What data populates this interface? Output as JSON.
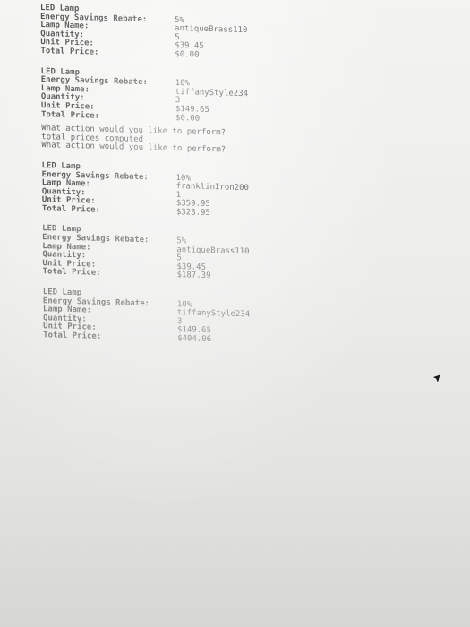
{
  "blocks": [
    {
      "header": "LED Lamp",
      "rows": [
        {
          "label": "Energy Savings Rebate:",
          "value": "5%"
        },
        {
          "label": "Lamp Name:",
          "value": "antiqueBrass110"
        },
        {
          "label": "Quantity:",
          "value": "5"
        },
        {
          "label": "Unit Price:",
          "value": "$39.45"
        },
        {
          "label": "Total Price:",
          "value": "$0.00"
        }
      ]
    },
    {
      "header": "LED Lamp",
      "rows": [
        {
          "label": "Energy Savings Rebate:",
          "value": "10%"
        },
        {
          "label": "Lamp Name:",
          "value": "tiffanyStyle234"
        },
        {
          "label": "Quantity:",
          "value": "3"
        },
        {
          "label": "Unit Price:",
          "value": "$149.65"
        },
        {
          "label": "Total Price:",
          "value": "$0.00"
        }
      ],
      "prompts": [
        "What action would you like to perform?",
        "total prices computed",
        "What action would you like to perform?"
      ]
    },
    {
      "header": "LED Lamp",
      "rows": [
        {
          "label": "Energy Savings Rebate:",
          "value": "10%"
        },
        {
          "label": "Lamp Name:",
          "value": "franklinIron200"
        },
        {
          "label": "Quantity:",
          "value": "1"
        },
        {
          "label": "Unit Price:",
          "value": "$359.95"
        },
        {
          "label": "Total Price:",
          "value": "$323.95"
        }
      ]
    },
    {
      "header": "LED Lamp",
      "rows": [
        {
          "label": "Energy Savings Rebate:",
          "value": "5%"
        },
        {
          "label": "Lamp Name:",
          "value": "antiqueBrass110"
        },
        {
          "label": "Quantity:",
          "value": "5"
        },
        {
          "label": "Unit Price:",
          "value": "$39.45"
        },
        {
          "label": "Total Price:",
          "value": "$187.39"
        }
      ]
    },
    {
      "header": "LED Lamp",
      "rows": [
        {
          "label": "Energy Savings Rebate:",
          "value": "10%"
        },
        {
          "label": "Lamp Name:",
          "value": "tiffanyStyle234"
        },
        {
          "label": "Quantity:",
          "value": "3"
        },
        {
          "label": "Unit Price:",
          "value": "$149.65"
        },
        {
          "label": "Total Price:",
          "value": "$404.06"
        }
      ]
    }
  ],
  "cursor_icon": "mouse-pointer-icon",
  "colors": {
    "text": "#2a2a2a",
    "background": "#ececea"
  }
}
